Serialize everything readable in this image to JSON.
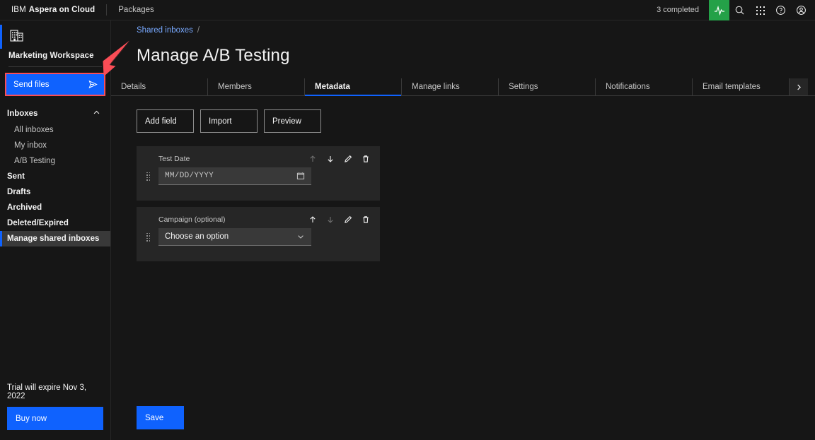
{
  "header": {
    "brand_ibm": "IBM",
    "brand_product": "Aspera on Cloud",
    "packages_label": "Packages",
    "status_text": "3 completed",
    "activity_icon": "activity-pulse-icon",
    "search_icon": "search-icon",
    "appgrid_icon": "app-switcher-icon",
    "help_icon": "help-icon",
    "avatar_icon": "user-avatar-icon"
  },
  "sidebar": {
    "workspace_icon": "office-building-icon",
    "workspace_name": "Marketing Workspace",
    "send_files_label": "Send files",
    "send_files_icon": "send-paper-plane-icon",
    "inboxes_group_label": "Inboxes",
    "inboxes_chevron_icon": "chevron-up-icon",
    "sub_items": [
      {
        "label": "All inboxes"
      },
      {
        "label": "My inbox"
      },
      {
        "label": "A/B Testing"
      }
    ],
    "items": [
      {
        "label": "Sent",
        "active": false
      },
      {
        "label": "Drafts",
        "active": false
      },
      {
        "label": "Archived",
        "active": false
      },
      {
        "label": "Deleted/Expired",
        "active": false
      },
      {
        "label": "Manage shared inboxes",
        "active": true
      }
    ],
    "trial_text": "Trial will expire Nov 3, 2022",
    "buy_now_label": "Buy now"
  },
  "main": {
    "breadcrumb_link": "Shared inboxes",
    "breadcrumb_separator": "/",
    "page_title": "Manage A/B Testing",
    "tabs": [
      {
        "label": "Details",
        "active": false
      },
      {
        "label": "Members",
        "active": false
      },
      {
        "label": "Metadata",
        "active": true
      },
      {
        "label": "Manage links",
        "active": false
      },
      {
        "label": "Settings",
        "active": false
      },
      {
        "label": "Notifications",
        "active": false
      },
      {
        "label": "Email templates",
        "active": false
      }
    ],
    "tab_next_icon": "chevron-right-icon",
    "actions": [
      {
        "label": "Add field"
      },
      {
        "label": "Import"
      },
      {
        "label": "Preview"
      }
    ],
    "fields": [
      {
        "label": "Test Date",
        "value": "MM/DD/YYYY",
        "input_kind": "date",
        "input_icon": "calendar-icon",
        "drag_icon": "drag-handle-icon",
        "move_up_icon": "arrow-up-icon",
        "move_down_icon": "arrow-down-icon",
        "edit_icon": "edit-pencil-icon",
        "delete_icon": "trash-icon",
        "up_enabled": false,
        "down_enabled": true
      },
      {
        "label": "Campaign (optional)",
        "value": "Choose an option",
        "input_kind": "select",
        "input_icon": "chevron-down-icon",
        "drag_icon": "drag-handle-icon",
        "move_up_icon": "arrow-up-icon",
        "move_down_icon": "arrow-down-icon",
        "edit_icon": "edit-pencil-icon",
        "delete_icon": "trash-icon",
        "up_enabled": true,
        "down_enabled": false
      }
    ],
    "save_label": "Save"
  },
  "annotation": {
    "arrow_icon": "red-pointer-arrow-icon",
    "highlight_color": "#fa4d56",
    "target": "send-files-button"
  },
  "colors": {
    "background": "#161616",
    "surface": "#262626",
    "field": "#393939",
    "accent_blue": "#0f62fe",
    "link_blue": "#78a9ff",
    "activity_green": "#24a148",
    "annotation_red": "#fa4d56"
  }
}
